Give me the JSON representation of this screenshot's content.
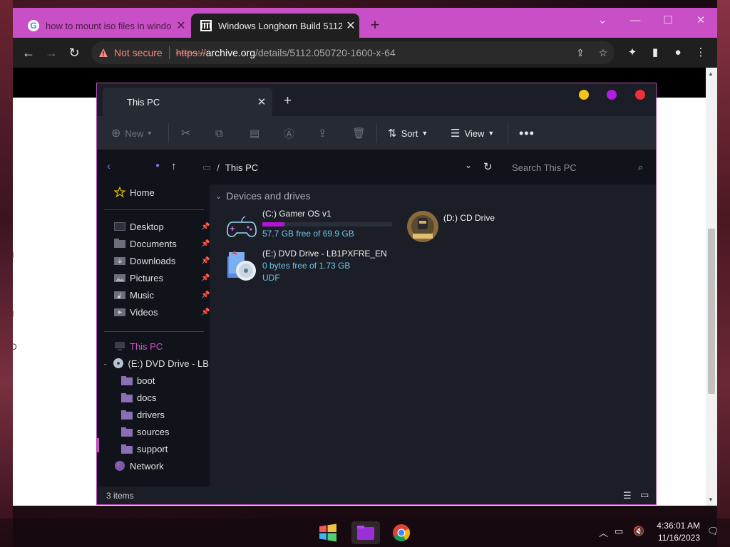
{
  "browser": {
    "tabs": [
      {
        "title": "how to mount iso files in windo",
        "active": false,
        "icon": "google-icon"
      },
      {
        "title": "Windows Longhorn Build 5112 :",
        "active": true,
        "icon": "archive-org-icon"
      }
    ],
    "address": {
      "security_label": "Not secure",
      "scheme": "https://",
      "host": "archive.org",
      "path": "/details/5112.050720-1600-x-64"
    },
    "page_fragments": [
      "R",
      "I",
      "I",
      "D"
    ]
  },
  "explorer": {
    "tab_title": "This PC",
    "toolbar": {
      "new_label": "New",
      "sort_label": "Sort",
      "view_label": "View"
    },
    "breadcrumb": {
      "separator": "/",
      "current": "This PC"
    },
    "search_placeholder": "Search This PC",
    "nav": {
      "home": "Home",
      "quick": [
        {
          "label": "Desktop"
        },
        {
          "label": "Documents"
        },
        {
          "label": "Downloads"
        },
        {
          "label": "Pictures"
        },
        {
          "label": "Music"
        },
        {
          "label": "Videos"
        }
      ],
      "this_pc": "This PC",
      "dvd": "(E:) DVD Drive - LB1P",
      "folders": [
        "boot",
        "docs",
        "drivers",
        "sources",
        "support"
      ],
      "network": "Network"
    },
    "group_header": "Devices and drives",
    "drives": [
      {
        "name": "(C:) Gamer OS v1",
        "free": "57.7 GB free of 69.9 GB",
        "used_fraction": 0.17
      },
      {
        "name": "(D:) CD Drive"
      },
      {
        "name": "(E:) DVD Drive - LB1PXFRE_EN",
        "free": "0 bytes free of 1.73 GB",
        "fs": "UDF"
      }
    ],
    "status": "3 items",
    "colors": {
      "accent": "#c94fc6",
      "free_text": "#6ec6e6",
      "bar_fill": "#b315d6"
    }
  },
  "taskbar": {
    "time": "4:36:01 AM",
    "date": "11/16/2023"
  }
}
